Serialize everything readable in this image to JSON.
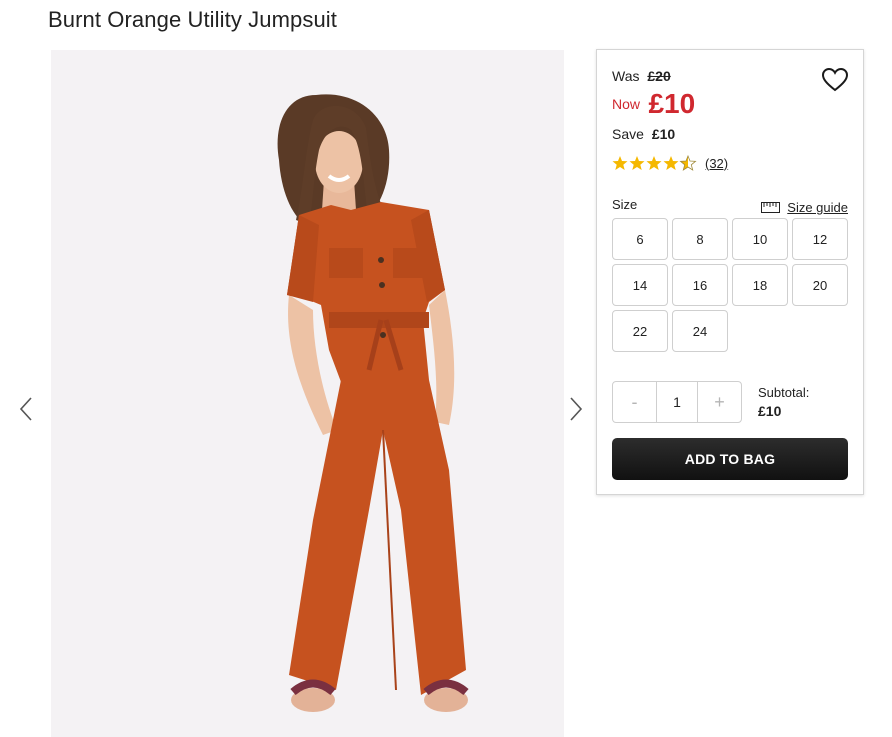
{
  "product": {
    "title": "Burnt Orange Utility Jumpsuit"
  },
  "gallery": {
    "image_alt": "Model wearing burnt orange utility jumpsuit",
    "prev_icon": "chevron-left-icon",
    "next_icon": "chevron-right-icon"
  },
  "pricing": {
    "was_label": "Was",
    "was_price": "£20",
    "now_label": "Now",
    "now_price": "£10",
    "save_label": "Save",
    "save_amount": "£10",
    "now_color": "#d0282f"
  },
  "rating": {
    "stars": 4.5,
    "max": 5,
    "count_text": "(32)",
    "star_color": "#f5b800"
  },
  "wishlist": {
    "icon": "heart-icon"
  },
  "size": {
    "label": "Size",
    "guide_label": "Size guide",
    "guide_icon": "ruler-icon",
    "options": [
      "6",
      "8",
      "10",
      "12",
      "14",
      "16",
      "18",
      "20",
      "22",
      "24"
    ]
  },
  "quantity": {
    "minus": "-",
    "value": "1",
    "plus": "+"
  },
  "subtotal": {
    "label": "Subtotal:",
    "value": "£10"
  },
  "cart": {
    "add_label": "ADD TO BAG"
  }
}
